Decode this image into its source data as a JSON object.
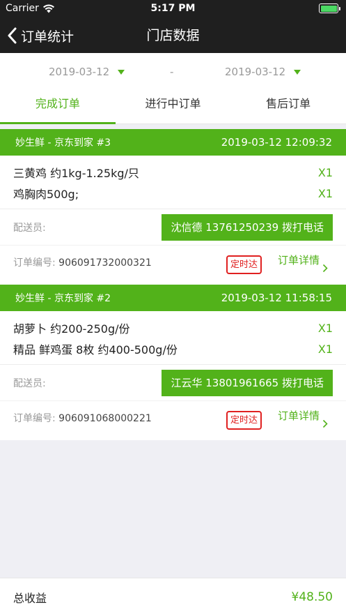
{
  "status_bar": {
    "carrier": "Carrier",
    "time": "5:17 PM"
  },
  "nav": {
    "back_label": "订单统计",
    "title": "门店数据"
  },
  "date_range": {
    "start": "2019-03-12",
    "separator": "-",
    "end": "2019-03-12"
  },
  "tabs": [
    {
      "label": "完成订单",
      "active": true
    },
    {
      "label": "进行中订单",
      "active": false
    },
    {
      "label": "售后订单",
      "active": false
    }
  ],
  "orders": [
    {
      "store": "妙生鲜 - 京东到家 #3",
      "time": "2019-03-12 12:09:32",
      "items": [
        {
          "name": "三黄鸡 约1kg-1.25kg/只",
          "qty": "X1"
        },
        {
          "name": "鸡胸肉500g;",
          "qty": "X1"
        }
      ],
      "courier_label": "配送员:",
      "call_button": "沈信德 13761250239 拨打电话",
      "order_no_label": "订单编号:",
      "order_no": "906091732000321",
      "badge": "定时达",
      "detail_link": "订单详情"
    },
    {
      "store": "妙生鲜 - 京东到家 #2",
      "time": "2019-03-12 11:58:15",
      "items": [
        {
          "name": "胡萝卜 约200-250g/份",
          "qty": "X1"
        },
        {
          "name": "精品 鲜鸡蛋 8枚 约400-500g/份",
          "qty": "X1"
        }
      ],
      "courier_label": "配送员:",
      "call_button": "江云华 13801961665 拨打电话",
      "order_no_label": "订单编号:",
      "order_no": "906091068000221",
      "badge": "定时达",
      "detail_link": "订单详情"
    }
  ],
  "footer": {
    "label": "总收益",
    "amount": "¥48.50"
  },
  "colors": {
    "accent": "#52b21a",
    "badge": "#e02020",
    "bar": "#1f1f1f"
  }
}
